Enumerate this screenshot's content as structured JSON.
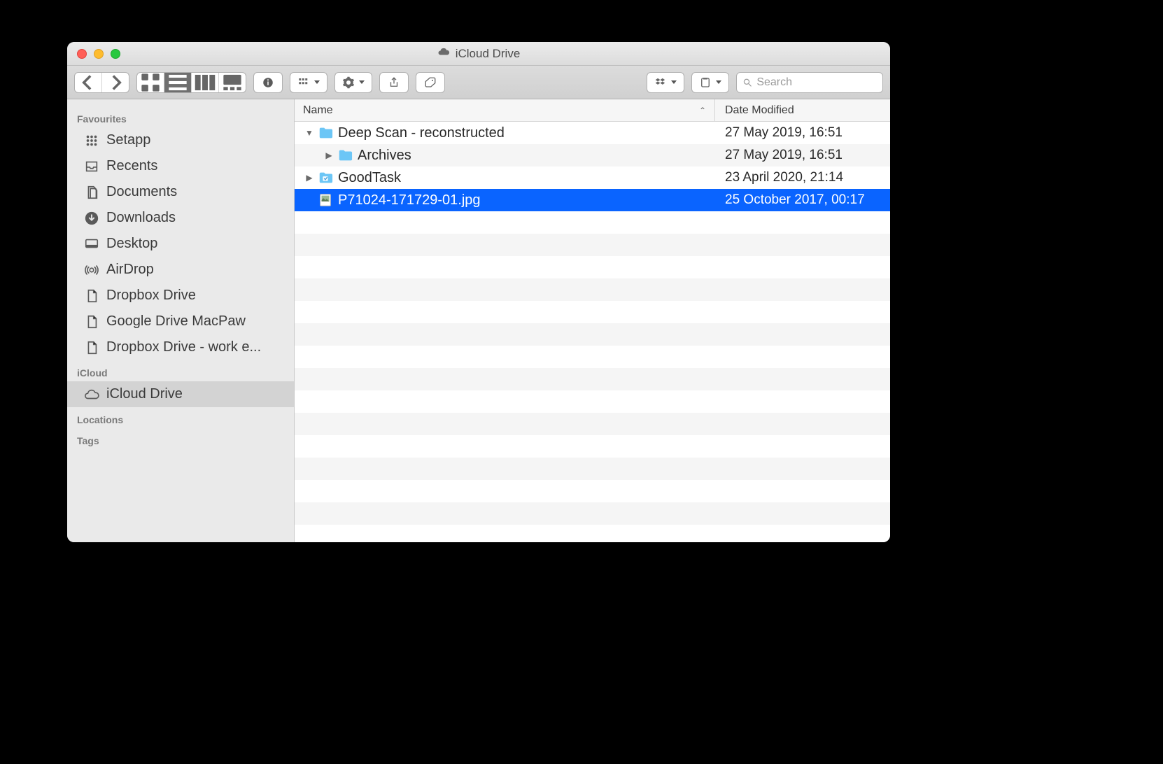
{
  "window_title": "iCloud Drive",
  "search_placeholder": "Search",
  "columns": {
    "name": "Name",
    "date": "Date Modified"
  },
  "sidebar": {
    "sections": [
      {
        "label": "Favourites",
        "items": [
          {
            "id": "setapp",
            "label": "Setapp",
            "icon": "grid-icon"
          },
          {
            "id": "recents",
            "label": "Recents",
            "icon": "tray-icon"
          },
          {
            "id": "documents",
            "label": "Documents",
            "icon": "documents-icon"
          },
          {
            "id": "downloads",
            "label": "Downloads",
            "icon": "download-icon"
          },
          {
            "id": "desktop",
            "label": "Desktop",
            "icon": "desktop-icon"
          },
          {
            "id": "airdrop",
            "label": "AirDrop",
            "icon": "airdrop-icon"
          },
          {
            "id": "dropbox-drive",
            "label": "Dropbox Drive",
            "icon": "file-icon"
          },
          {
            "id": "gdrive-macpaw",
            "label": "Google Drive MacPaw",
            "icon": "file-icon"
          },
          {
            "id": "dropbox-work",
            "label": "Dropbox Drive - work e...",
            "icon": "file-icon"
          }
        ]
      },
      {
        "label": "iCloud",
        "items": [
          {
            "id": "icloud-drive",
            "label": "iCloud Drive",
            "icon": "cloud-icon",
            "selected": true
          }
        ]
      },
      {
        "label": "Locations",
        "items": []
      },
      {
        "label": "Tags",
        "items": []
      }
    ]
  },
  "files": [
    {
      "name": "Deep Scan - reconstructed",
      "date": "27 May 2019, 16:51",
      "kind": "folder",
      "indent": 0,
      "expanded": true,
      "has_children": true
    },
    {
      "name": "Archives",
      "date": "27 May 2019, 16:51",
      "kind": "folder",
      "indent": 1,
      "expanded": false,
      "has_children": true
    },
    {
      "name": "GoodTask",
      "date": "23 April 2020, 21:14",
      "kind": "folder-app",
      "indent": 0,
      "expanded": false,
      "has_children": true
    },
    {
      "name": "P71024-171729-01.jpg",
      "date": "25 October 2017, 00:17",
      "kind": "image",
      "indent": 0,
      "expanded": false,
      "has_children": false,
      "selected": true
    }
  ]
}
